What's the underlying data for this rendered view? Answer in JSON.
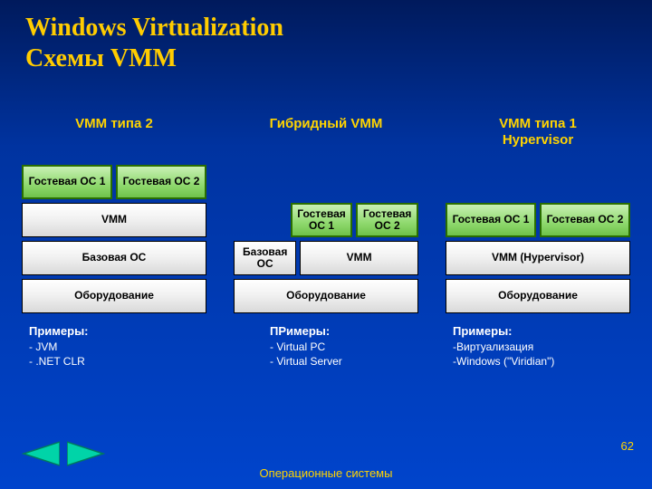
{
  "title": {
    "line1": "Windows Virtualization",
    "line2": "Схемы VMM"
  },
  "columns": [
    {
      "heading": "VMM типа 2",
      "guest1": "Гостевая ОС 1",
      "guest2": "Гостевая ОС 2",
      "vmm": "VMM",
      "host": "Базовая ОС",
      "hw": "Оборудование",
      "examples_head": "Примеры:",
      "examples": [
        "- JVM",
        "- .NET CLR"
      ]
    },
    {
      "heading": "Гибридный VMM",
      "guest1": "Гостевая ОС 1",
      "guest2": "Гостевая ОС 2",
      "host": "Базовая ОС",
      "vmm": "VMM",
      "hw": "Оборудование",
      "examples_head": "ПРимеры:",
      "examples": [
        "- Virtual PC",
        "- Virtual Server"
      ]
    },
    {
      "heading": "VMM типа 1\nHypervisor",
      "guest1": "Гостевая ОС 1",
      "guest2": "Гостевая ОС 2",
      "vmm": "VMM (Hypervisor)",
      "hw": "Оборудование",
      "examples_head": "Примеры:",
      "examples": [
        "-Виртуализация",
        "-Windows (\"Viridian\")"
      ]
    }
  ],
  "page_number": "62",
  "footer": "Операционные системы",
  "nav": {
    "prev": "prev-slide",
    "next": "next-slide"
  }
}
